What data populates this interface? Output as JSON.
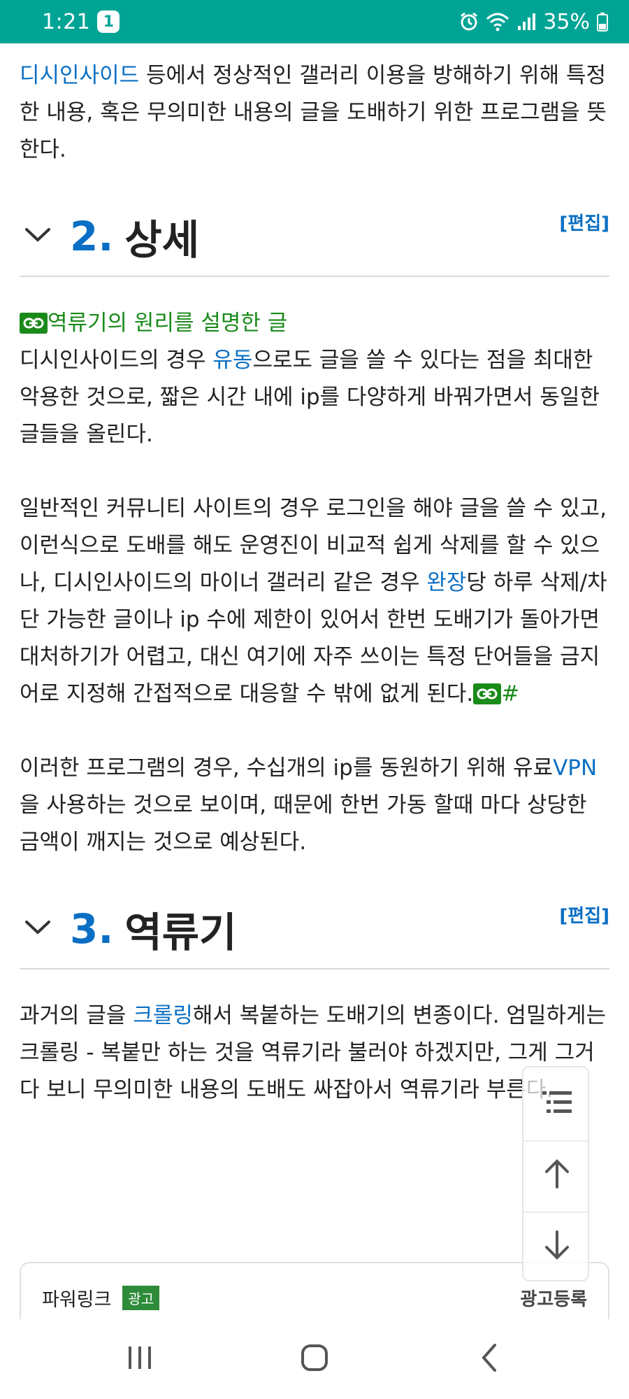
{
  "status_bar": {
    "time": "1:21",
    "notification_count": "1",
    "battery": "35%"
  },
  "intro": {
    "link": "디시인사이드",
    "text": " 등에서 정상적인 갤러리 이용을 방해하기 위해 특정한 내용, 혹은 무의미한 내용의 글을 도배하기 위한 프로그램을 뜻한다."
  },
  "section2": {
    "number": "2.",
    "title": "상세",
    "edit": "[편집]",
    "ext_link": "역류기의 원리를 설명한 글",
    "p1_a": "디시인사이드의 경우 ",
    "p1_link": "유동",
    "p1_b": "으로도 글을 쓸 수 있다는 점을 최대한 악용한 것으로, 짧은 시간 내에 ip를 다양하게 바꿔가면서 동일한 글들을 올린다.",
    "p2_a": "일반적인 커뮤니티 사이트의 경우 로그인을 해야 글을 쓸 수 있고, 이런식으로 도배를 해도 운영진이 비교적 쉽게 삭제를 할 수 있으나, 디시인사이드의 마이너 갤러리 같은 경우 ",
    "p2_link": "완장",
    "p2_b": "당 하루 삭제/차단 가능한 글이나 ip 수에 제한이 있어서 한번 도배기가 돌아가면 대처하기가 어렵고, 대신 여기에 자주 쓰이는 특정 단어들을 금지어로 지정해 간접적으로 대응할 수 밖에 없게 된다.",
    "p2_hash": "#",
    "p3_a": "이러한 프로그램의 경우, 수십개의 ip를 동원하기 위해 유료",
    "p3_link": "VPN",
    "p3_b": "을 사용하는 것으로 보이며, 때문에 한번 가동 할때 마다 상당한 금액이 깨지는 것으로 예상된다."
  },
  "section3": {
    "number": "3.",
    "title": "역류기",
    "edit": "[편집]",
    "p1_a": "과거의 글을 ",
    "p1_link": "크롤링",
    "p1_b": "해서 복붙하는 도배기의 변종이다. 엄밀하게는 크롤링 - 복붙만 하는 것을 역류기라 불러야 하겠지만, 그게 그거다 보니 무의미한 내용의 도배도 싸잡아서 역류기라 부른다."
  },
  "powerlink": {
    "title": "파워링크",
    "ad_badge": "광고",
    "register": "광고등록"
  },
  "colors": {
    "status_bar": "#00a495",
    "link_blue": "#0a6fc4",
    "external_green": "#1a8a1a"
  },
  "icons": [
    "alarm-icon",
    "wifi-icon",
    "signal-icon",
    "battery-icon",
    "chevron-down-icon",
    "external-link-icon",
    "toc-icon",
    "arrow-up-icon",
    "arrow-down-icon",
    "recents-icon",
    "home-icon",
    "back-icon"
  ]
}
